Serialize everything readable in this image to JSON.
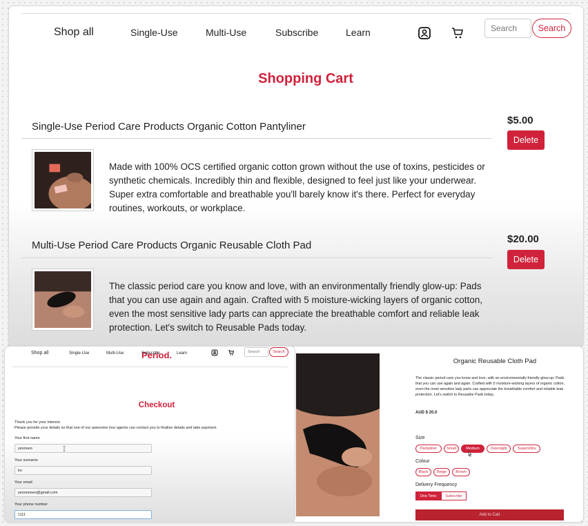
{
  "colors": {
    "accent": "#d0223b",
    "text": "#222222",
    "muted_border": "#cccccc"
  },
  "cart_page": {
    "nav": {
      "shop_all": "Shop all",
      "single_use": "Single-Use",
      "multi_use": "Multi-Use",
      "subscribe": "Subscribe",
      "learn": "Learn",
      "account_icon": "account-icon",
      "cart_icon": "cart-icon",
      "search_placeholder": "Search",
      "search_button": "Search"
    },
    "title": "Shopping Cart",
    "items": [
      {
        "title": "Single-Use Period Care Products Organic Cotton Pantyliner",
        "price": "$5.00",
        "delete_label": "Delete",
        "description": "Made with 100% OCS certified organic cotton grown without the use of toxins, pesticides or synthetic chemicals. Incredibly thin and flexible, designed to feel just like your underwear. Super extra comfortable and breathable you'll barely know it's there. Perfect for everyday routines, workouts, or workplace."
      },
      {
        "title": "Multi-Use Period Care Products Organic Reusable Cloth Pad",
        "price": "$20.00",
        "delete_label": "Delete",
        "description": "The classic period care you know and love, with an environmentally friendly glow-up: Pads that you can use again and again. Crafted with 5 moisture-wicking layers of organic cotton, even the most sensitive lady parts can appreciate the breathable comfort and reliable leak protection. Let's switch to Reusable Pads today."
      }
    ]
  },
  "checkout_page": {
    "brand": "Period.",
    "nav": {
      "shop_all": "Shop all",
      "single_use": "Single-Use",
      "multi_use": "Multi-Use",
      "subscribe": "Subscribe",
      "learn": "Learn",
      "search_placeholder": "Search",
      "search_button": "Search"
    },
    "title": "Checkout",
    "note_line1": "Thank you for your interest.",
    "note_line2": "Please provide your details so that one of our awesome tour agents can contact you to finalise details and take payment.",
    "fields": [
      {
        "label": "Your first name",
        "value": "yeonseo"
      },
      {
        "label": "Your surname",
        "value": "ko"
      },
      {
        "label": "Your email",
        "value": "yeooonseo@gmail.com"
      },
      {
        "label": "Your phone number",
        "value": "1111"
      }
    ]
  },
  "product_page": {
    "title": "Organic Reusable Cloth Pad",
    "description": "The classic period care you know and love, with an environmentally friendly glow-up: Pads that you can use again and again. Crafted with 5 moisture-wicking layers of organic cotton, even the most sensitive lady parts can appreciate the breathable comfort and reliable leak protection. Let's switch to Reusable Pads today.",
    "price": "AUD $ 20.0",
    "size_label": "Size",
    "sizes": [
      "Pantyliner",
      "Small",
      "Medium",
      "Overnight",
      "SuperUltra"
    ],
    "selected_size": "Medium",
    "colour_label": "Colour",
    "colours": [
      "Black",
      "Beige",
      "Brown"
    ],
    "frequency_label": "Delivery Frequency",
    "frequencies": [
      "One Time",
      "Subscribe"
    ],
    "selected_frequency": "One Time",
    "add_to_cart": "Add to Cart"
  }
}
